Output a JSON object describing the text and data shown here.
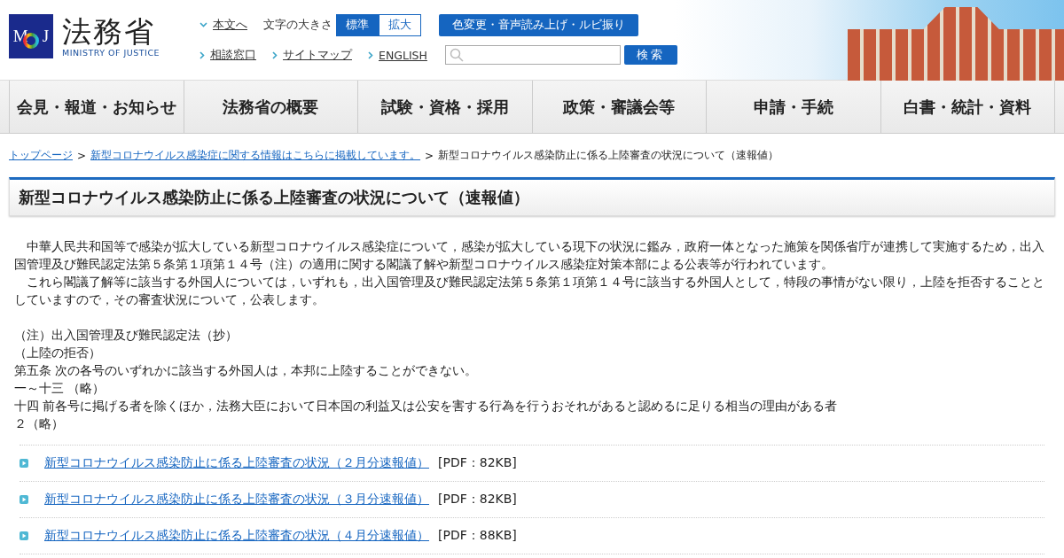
{
  "header": {
    "logo_mark": [
      "M",
      "J"
    ],
    "site_name": "法務省",
    "site_name_en": "MINISTRY OF JUSTICE",
    "top_links": [
      {
        "label": "本文へ"
      }
    ],
    "font_size_label": "文字の大きさ",
    "font_size_options": [
      {
        "label": "標準",
        "selected": true
      },
      {
        "label": "拡大",
        "selected": false
      }
    ],
    "accessibility_button": "色変更・音声読み上げ・ルビ振り",
    "links": [
      {
        "label": "相談窓口"
      },
      {
        "label": "サイトマップ"
      },
      {
        "label": "ENGLISH"
      }
    ],
    "search": {
      "button": "検索"
    }
  },
  "nav": {
    "items": [
      {
        "label": "会見・報道・お知らせ"
      },
      {
        "label": "法務省の概要"
      },
      {
        "label": "試験・資格・採用"
      },
      {
        "label": "政策・審議会等"
      },
      {
        "label": "申請・手続"
      },
      {
        "label": "白書・統計・資料"
      }
    ]
  },
  "breadcrumb": [
    {
      "kind": "link",
      "label": "トップページ"
    },
    {
      "kind": "separator",
      "label": ">"
    },
    {
      "kind": "link",
      "label": "新型コロナウイルス感染症に関する情報はこちらに掲載しています。"
    },
    {
      "kind": "separator",
      "label": ">"
    },
    {
      "kind": "current",
      "label": "新型コロナウイルス感染防止に係る上陸審査の状況について（速報値）"
    }
  ],
  "page_title": "新型コロナウイルス感染防止に係る上陸審査の状況について（速報値）",
  "paragraphs": [
    "　中華人民共和国等で感染が拡大している新型コロナウイルス感染症について，感染が拡大している現下の状況に鑑み，政府一体となった施策を関係省庁が連携して実施するため，出入国管理及び難民認定法第５条第１項第１４号（注）の適用に関する閣議了解や新型コロナウイルス感染症対策本部による公表等が行われています。",
    "　これら閣議了解等に該当する外国人については，いずれも，出入国管理及び難民認定法第５条第１項第１４号に該当する外国人として，特段の事情がない限り，上陸を拒否することとしていますので，その審査状況について，公表します。"
  ],
  "note_lines": [
    "（注）出入国管理及び難民認定法（抄）",
    "（上陸の拒否）",
    "第五条 次の各号のいずれかに該当する外国人は，本邦に上陸することができない。",
    "一～十三 （略）",
    "十四 前各号に掲げる者を除くほか，法務大臣において日本国の利益又は公安を害する行為を行うおそれがあると認めるに足りる相当の理由がある者",
    "２（略）"
  ],
  "documents": [
    {
      "title": "新型コロナウイルス感染防止に係る上陸審査の状況（２月分速報値）",
      "size": "[PDF：82KB]"
    },
    {
      "title": "新型コロナウイルス感染防止に係る上陸審査の状況（３月分速報値）",
      "size": "[PDF：82KB]"
    },
    {
      "title": "新型コロナウイルス感染防止に係る上陸審査の状況（４月分速報値）",
      "size": "[PDF：88KB]"
    }
  ]
}
